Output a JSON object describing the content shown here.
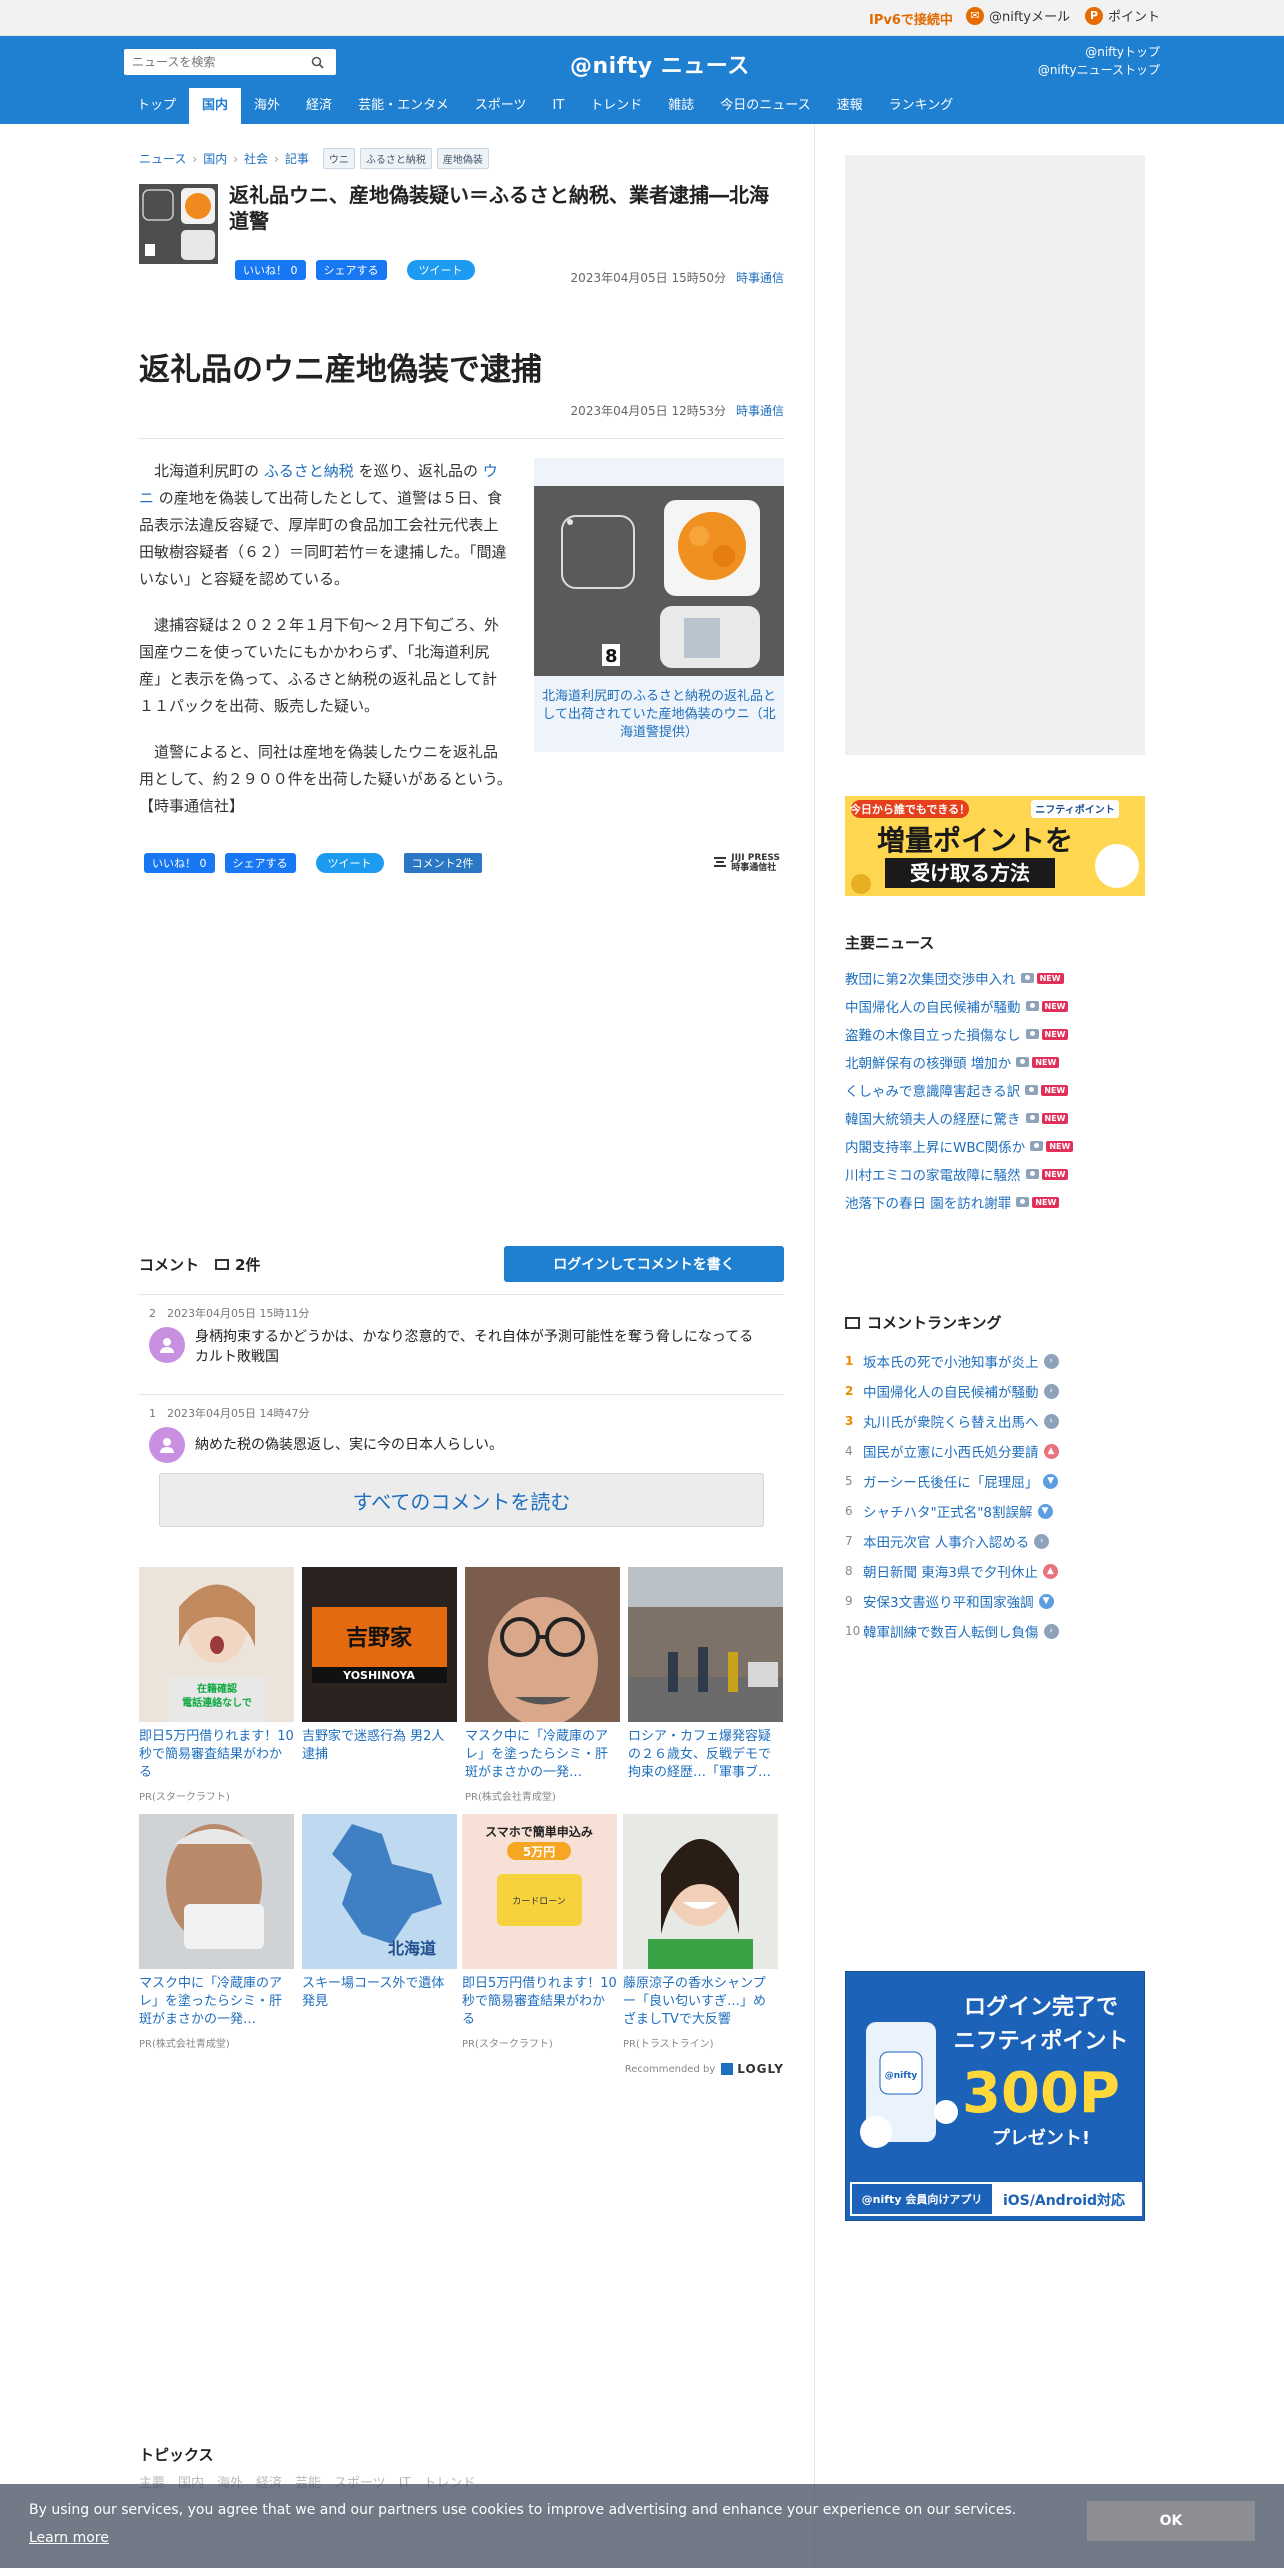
{
  "utilbar": {
    "ipv6": "IPv6で接続中",
    "mail": "@niftyメール",
    "point": "ポイント"
  },
  "header": {
    "search_placeholder": "ニュースを検索",
    "logo": "@nifty ニュース",
    "links": [
      "@niftyトップ",
      "@niftyニューストップ"
    ],
    "nav": [
      "トップ",
      "国内",
      "海外",
      "経済",
      "芸能・エンタメ",
      "スポーツ",
      "IT",
      "トレンド",
      "雑誌",
      "今日のニュース",
      "速報",
      "ランキング"
    ],
    "active_nav": "国内"
  },
  "breadcrumb": [
    "ニュース",
    "国内",
    "社会",
    "記事"
  ],
  "tags": [
    "ウニ",
    "ふるさと納税",
    "産地偽装"
  ],
  "article": {
    "headline": "返礼品ウニ、産地偽装疑い＝ふるさと納税、業者逮捕―北海道警",
    "meta_date": "2023年04月05日 15時50分",
    "source": "時事通信",
    "title": "返礼品のウニ産地偽装で逮捕",
    "title_date": "2023年04月05日 12時53分",
    "p1_a": "北海道利尻町の ",
    "p1_link1": "ふるさと納税",
    "p1_b": " を巡り、返礼品の ",
    "p1_link2": "ウニ",
    "p1_c": " の産地を偽装して出荷したとして、道警は５日、食品表示法違反容疑で、厚岸町の食品加工会社元代表上田敏樹容疑者（６２）＝同町若竹＝を逮捕した。「間違いない」と容疑を認めている。",
    "p2": "逮捕容疑は２０２２年１月下旬～２月下旬ごろ、外国産ウニを使っていたにもかかわらず、「北海道利尻産」と表示を偽って、ふるさと納税の返礼品として計１１パックを出荷、販売した疑い。",
    "p3": "道警によると、同社は産地を偽装したウニを返礼品用として、約２９００件を出荷した疑いがあるという。　【時事通信社】",
    "caption": "北海道利尻町のふるさと納税の返礼品として出荷されていた産地偽装のウニ（北海道警提供）",
    "photo_number": "8"
  },
  "share": {
    "like": "いいね！ 0",
    "share": "シェアする",
    "tweet": "ツイート",
    "comment": "コメント2件"
  },
  "jiji_logo": [
    "JIJI PRESS",
    "時事通信社"
  ],
  "comments": {
    "label": "コメント",
    "count": "2件",
    "login_button": "ログインしてコメントを書く",
    "items": [
      {
        "meta": "2　2023年04月05日 15時11分",
        "text": "身柄拘束するかどうかは、かなり恣意的で、それ自体が予測可能性を奪う脅しになってるカルト敗戦国"
      },
      {
        "meta": "1　2023年04月05日 14時47分",
        "text": "納めた税の偽装恩返し、実に今の日本人らしい。"
      }
    ],
    "all_button": "すべてのコメントを読む"
  },
  "recommend": {
    "items": [
      {
        "title": "即日5万円借りれます！10秒で簡易審査結果がわかる",
        "pr": "PR(スタークラフト)",
        "img_text": "在籍確認電話連絡なしで借りられるカードローン!?"
      },
      {
        "title": "吉野家で迷惑行為 男2人逮捕",
        "pr": "",
        "img_text": "吉野家 YOSHINOYA"
      },
      {
        "title": "マスク中に「冷蔵庫のアレ」を塗ったらシミ・肝斑がまさかの一発…",
        "pr": "PR(株式会社青成堂)",
        "img_text": ""
      },
      {
        "title": "ロシア・カフェ爆発容疑の２６歳女、反戦デモで拘束の経歴…「軍事ブ…",
        "pr": "",
        "img_text": ""
      },
      {
        "title": "マスク中に「冷蔵庫のアレ」を塗ったらシミ・肝斑がまさかの一発…",
        "pr": "PR(株式会社青成堂)",
        "img_text": ""
      },
      {
        "title": "スキー場コース外で遺体発見",
        "pr": "",
        "img_text": "北海道"
      },
      {
        "title": "即日5万円借りれます！10秒で簡易審査結果がわかる",
        "pr": "PR(スタークラフト)",
        "img_text": "スマホで簡単申込み 5万円 カードローン"
      },
      {
        "title": "藤原涼子の香水シャンプー「良い匂いすぎ…」めざましTVで大反響",
        "pr": "PR(トラストライン)",
        "img_text": ""
      }
    ],
    "recommended_by": "Recommended by",
    "logly": "LOGLY"
  },
  "topics": {
    "title": "トピックス",
    "sub": "主要　国内　海外　経済　芸能　スポーツ　IT　トレンド"
  },
  "sidebar": {
    "banner1": {
      "top": "今日から誰でもできる！",
      "brand": "ニフティポイント",
      "main": "増量ポイントを",
      "sub": "受け取る方法"
    },
    "main_news_title": "主要ニュース",
    "main_news": [
      "教団に第2次集団交渉申入れ",
      "中国帰化人の自民候補が騒動",
      "盗難の木像目立った損傷なし",
      "北朝鮮保有の核弾頭 増加か",
      "くしゃみで意識障害起きる訳",
      "韓国大統領夫人の経歴に驚き",
      "内閣支持率上昇にWBC関係か",
      "川村エミコの家電故障に騒然",
      "池落下の春日 園を訪れ謝罪"
    ],
    "new_badge": "NEW",
    "ranking_title": "コメントランキング",
    "ranking": [
      {
        "num": "1",
        "text": "坂本氏の死で小池知事が炎上",
        "trend": "same"
      },
      {
        "num": "2",
        "text": "中国帰化人の自民候補が騒動",
        "trend": "same"
      },
      {
        "num": "3",
        "text": "丸川氏が衆院くら替え出馬へ",
        "trend": "same"
      },
      {
        "num": "4",
        "text": "国民が立憲に小西氏処分要請",
        "trend": "up"
      },
      {
        "num": "5",
        "text": "ガーシー氏後任に「屁理屈」",
        "trend": "down"
      },
      {
        "num": "6",
        "text": "シャチハタ\"正式名\"8割誤解",
        "trend": "down"
      },
      {
        "num": "7",
        "text": "本田元次官 人事介入認める",
        "trend": "same"
      },
      {
        "num": "8",
        "text": "朝日新聞 東海3県で夕刊休止",
        "trend": "up"
      },
      {
        "num": "9",
        "text": "安保3文書巡り平和国家強調",
        "trend": "down"
      },
      {
        "num": "10",
        "text": "韓軍訓練で数百人転倒し負傷",
        "trend": "same"
      }
    ],
    "banner2": {
      "l1": "ログイン完了で",
      "l2": "ニフティポイント",
      "l3": "300P",
      "l4": "プレゼント!",
      "app_label": "@nifty 会員向けアプリ",
      "os": "iOS/Android対応",
      "app_icon": "@nifty"
    }
  },
  "cookie": {
    "text": "By using our services, you agree that we and our partners use cookies to improve advertising and enhance your experience on our services.",
    "learn": "Learn more",
    "ok": "OK"
  }
}
